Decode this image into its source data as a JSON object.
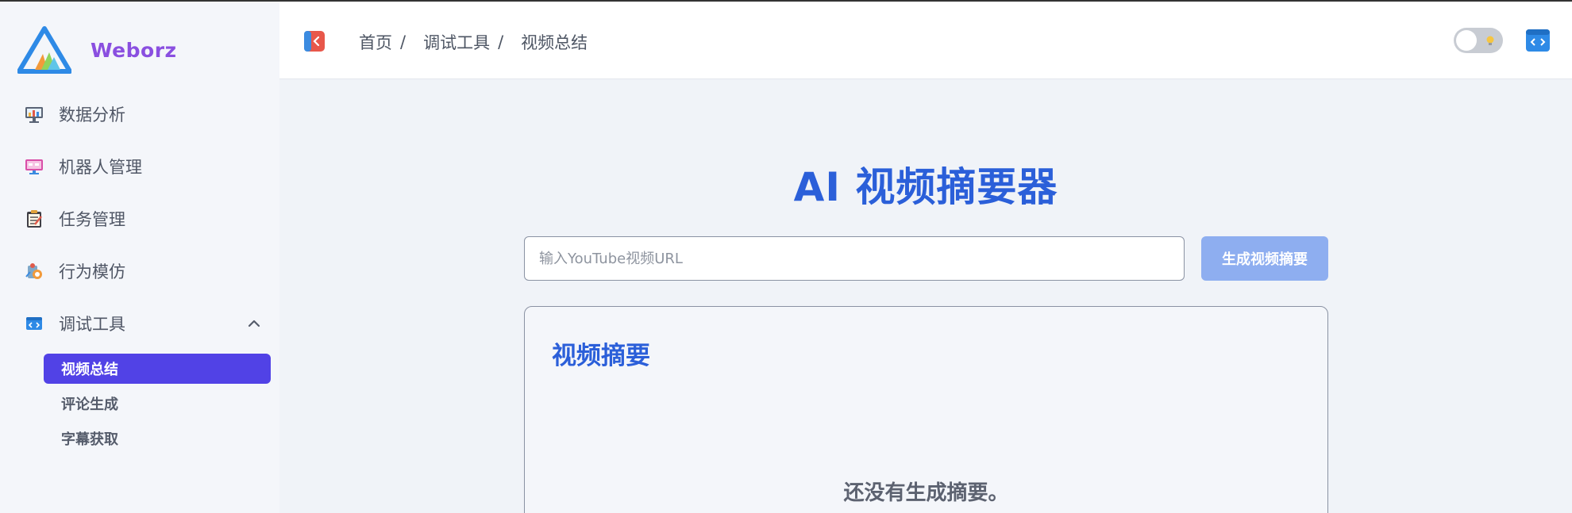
{
  "brand": {
    "name": "Weborz"
  },
  "sidebar": {
    "items": [
      {
        "label": "数据分析",
        "icon": "monitor-chart-icon"
      },
      {
        "label": "机器人管理",
        "icon": "robot-screen-icon"
      },
      {
        "label": "任务管理",
        "icon": "clipboard-icon"
      },
      {
        "label": "行为模仿",
        "icon": "behavior-icon"
      },
      {
        "label": "调试工具",
        "icon": "code-window-icon",
        "expanded": true
      }
    ],
    "subitems": [
      {
        "label": "视频总结",
        "active": true
      },
      {
        "label": "评论生成",
        "active": false
      },
      {
        "label": "字幕获取",
        "active": false
      }
    ]
  },
  "header": {
    "breadcrumb": [
      "首页",
      "调试工具",
      "视频总结"
    ],
    "separator": "/",
    "theme_toggle": "off"
  },
  "main": {
    "title": "AI 视频摘要器",
    "url_input": {
      "placeholder": "输入YouTube视频URL",
      "value": ""
    },
    "generate_button": "生成视频摘要",
    "summary_card": {
      "title": "视频摘要",
      "empty_message": "还没有生成摘要。"
    }
  },
  "colors": {
    "accent": "#2b5fd9",
    "active_nav": "#5142e6",
    "brand_text": "#8a4fe0",
    "button_disabled": "#8eaef0"
  }
}
